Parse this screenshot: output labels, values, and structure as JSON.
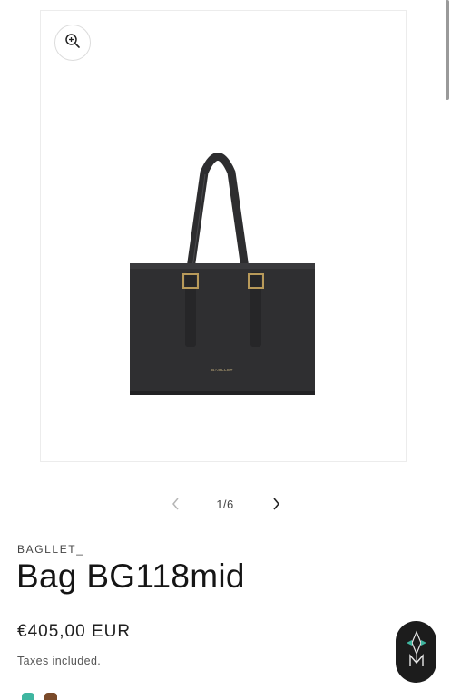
{
  "gallery": {
    "counter": "1/6",
    "zoom_icon": "zoom-in-icon",
    "prev_icon": "chevron-left-icon",
    "next_icon": "chevron-right-icon",
    "product_brand_stamp": "BAGLLET"
  },
  "product": {
    "vendor": "BAGLLET_",
    "title": "Bag BG118mid",
    "price": "€405,00 EUR",
    "tax_note": "Taxes included."
  },
  "chat": {
    "icon": "chat-logo-icon"
  },
  "colors": {
    "accent_dark": "#1c1c1c",
    "swatch_teal": "#3fb6a0",
    "swatch_brown": "#7a4a2a"
  }
}
